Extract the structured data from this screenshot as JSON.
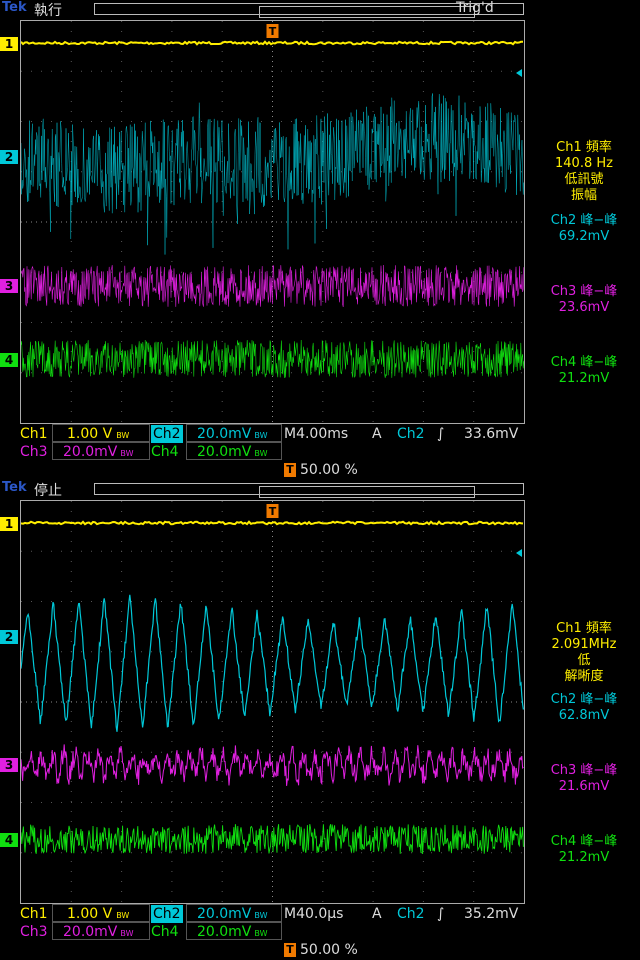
{
  "colors": {
    "ch1": "#ffee00",
    "ch2": "#00c8d8",
    "ch3": "#e020e0",
    "ch4": "#10e010",
    "orange": "#f07a00"
  },
  "screens": [
    {
      "brand": "Tek",
      "state": "執行",
      "trig_status": "Trig'd",
      "markers": [
        "1",
        "2",
        "3",
        "4"
      ],
      "ch2_style": "noise",
      "readouts": {
        "ch1_line1": "Ch1 頻率",
        "ch1_line2": "140.8 Hz",
        "ch1_line3": "低訊號",
        "ch1_line4": "振幅",
        "ch2_line1": "Ch2 峰−峰",
        "ch2_line2": "69.2mV",
        "ch3_line1": "Ch3 峰−峰",
        "ch3_line2": "23.6mV",
        "ch4_line1": "Ch4 峰−峰",
        "ch4_line2": "21.2mV"
      },
      "bottom": {
        "ch1_label": "Ch1",
        "ch1_scale": "1.00 V",
        "ch2_label": "Ch2",
        "ch2_scale": "20.0mV",
        "ch3_label": "Ch3",
        "ch3_scale": "20.0mV",
        "ch4_label": "Ch4",
        "ch4_scale": "20.0mV",
        "bw": "BW",
        "timebase": "M4.00ms",
        "trig_mode": "A",
        "trig_source": "Ch2",
        "trig_slope": "∫",
        "trig_level": "33.6mV",
        "trig_pos": "50.00 %",
        "t_marker": "T"
      }
    },
    {
      "brand": "Tek",
      "state": "停止",
      "trig_status": "",
      "markers": [
        "1",
        "2",
        "3",
        "4"
      ],
      "ch2_style": "sawtooth",
      "readouts": {
        "ch1_line1": "Ch1 頻率",
        "ch1_line2": "2.091MHz",
        "ch1_line3": "低",
        "ch1_line4": "解晰度",
        "ch2_line1": "Ch2 峰−峰",
        "ch2_line2": "62.8mV",
        "ch3_line1": "Ch3 峰−峰",
        "ch3_line2": "21.6mV",
        "ch4_line1": "Ch4 峰−峰",
        "ch4_line2": "21.2mV"
      },
      "bottom": {
        "ch1_label": "Ch1",
        "ch1_scale": "1.00 V",
        "ch2_label": "Ch2",
        "ch2_scale": "20.0mV",
        "ch3_label": "Ch3",
        "ch3_scale": "20.0mV",
        "ch4_label": "Ch4",
        "ch4_scale": "20.0mV",
        "bw": "BW",
        "timebase": "M40.0µs",
        "trig_mode": "A",
        "trig_source": "Ch2",
        "trig_slope": "∫",
        "trig_level": "35.2mV",
        "trig_pos": "50.00 %",
        "t_marker": "T"
      }
    }
  ]
}
